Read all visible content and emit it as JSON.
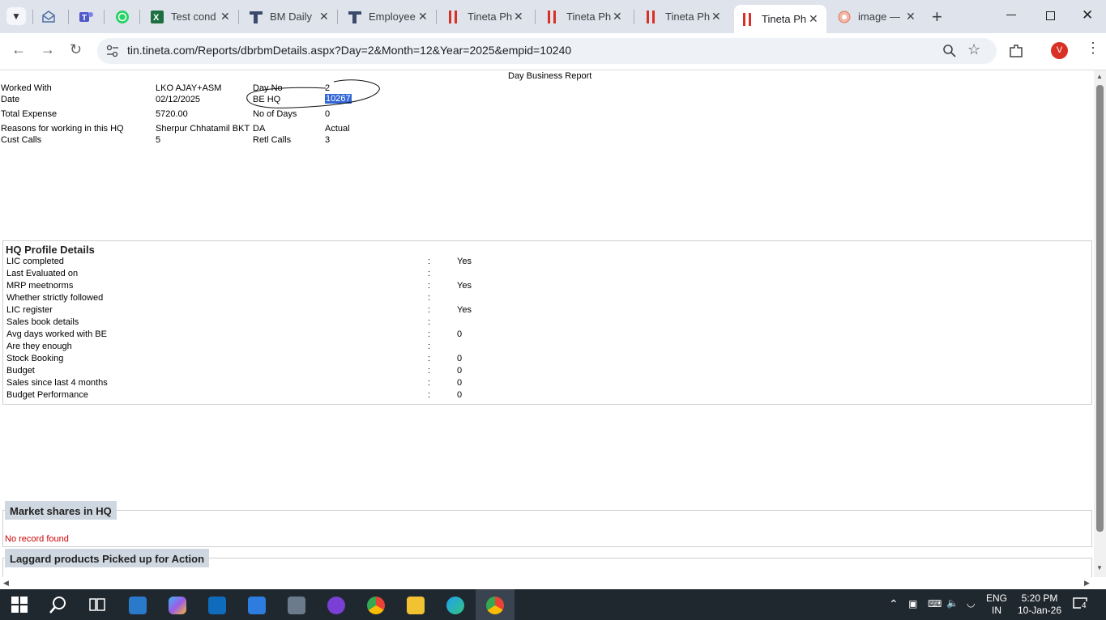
{
  "browser": {
    "tabs": [
      {
        "title": "",
        "icon": "tab-search-icon"
      },
      {
        "title": "",
        "icon": "mail-icon"
      },
      {
        "title": "",
        "icon": "teams-icon"
      },
      {
        "title": "",
        "icon": "whatsapp-icon"
      },
      {
        "title": "Test cond",
        "icon": "excel-icon"
      },
      {
        "title": "BM Daily",
        "icon": "tineta-t-icon"
      },
      {
        "title": "Employee",
        "icon": "tineta-t-icon"
      },
      {
        "title": "Tineta Ph",
        "icon": "tineta-bars-icon"
      },
      {
        "title": "Tineta Ph",
        "icon": "tineta-bars-icon"
      },
      {
        "title": "Tineta Ph",
        "icon": "tineta-bars-icon"
      },
      {
        "title": "Tineta Ph",
        "icon": "tineta-bars-icon"
      },
      {
        "title": "image —",
        "icon": "image-icon"
      }
    ],
    "url": "tin.tineta.com/Reports/dbrbmDetails.aspx?Day=2&Month=12&Year=2025&empid=10240",
    "profile_initial": "V"
  },
  "report": {
    "title": "Day Business Report",
    "fields": {
      "worked_with_label": "Worked With",
      "worked_with_value": "LKO AJAY+ASM",
      "date_label": "Date",
      "date_value": "02/12/2025",
      "total_expense_label": "Total Expense",
      "total_expense_value": "5720.00",
      "reasons_label": "Reasons for working in this HQ",
      "reasons_value": "Sherpur Chhatamil BKT",
      "cust_calls_label": "Cust Calls",
      "cust_calls_value": "5",
      "day_no_label": "Day No",
      "day_no_value": "2",
      "be_hq_label": "BE HQ",
      "be_hq_value": "10267",
      "no_of_days_label": "No of Days",
      "no_of_days_value": "0",
      "da_label": "DA",
      "da_value": "Actual",
      "retl_calls_label": "Retl Calls",
      "retl_calls_value": "3"
    },
    "hq_profile": {
      "heading": "HQ Profile Details",
      "rows": [
        {
          "label": "LIC completed",
          "sep": ":",
          "value": "Yes"
        },
        {
          "label": "Last Evaluated on",
          "sep": ":",
          "value": ""
        },
        {
          "label": "MRP meetnorms",
          "sep": ":",
          "value": "Yes"
        },
        {
          "label": "Whether strictly followed",
          "sep": ":",
          "value": ""
        },
        {
          "label": "LIC register",
          "sep": ":",
          "value": "Yes"
        },
        {
          "label": "Sales book details",
          "sep": ":",
          "value": ""
        },
        {
          "label": "Avg days worked with BE",
          "sep": ":",
          "value": "0"
        },
        {
          "label": "Are they enough",
          "sep": ":",
          "value": ""
        },
        {
          "label": "Stock Booking",
          "sep": ":",
          "value": "0"
        },
        {
          "label": "Budget",
          "sep": ":",
          "value": "0"
        },
        {
          "label": "Sales since last 4 months",
          "sep": ":",
          "value": "0"
        },
        {
          "label": "Budget Performance",
          "sep": ":",
          "value": "0"
        }
      ]
    },
    "market_shares": {
      "heading": "Market shares in HQ",
      "empty_text": "No record found"
    },
    "laggard": {
      "heading": "Laggard products Picked up for Action"
    }
  },
  "taskbar": {
    "lang_line1": "ENG",
    "lang_line2": "IN",
    "time": "5:20 PM",
    "date": "10-Jan-26",
    "notification_count": "4"
  },
  "colors": {
    "tab_strip": "#dfe3eb",
    "accent_red": "#d93025",
    "selection": "#3367d6",
    "section_header": "#cfd7e0",
    "no_record": "#cc0000",
    "taskbar": "#20282f"
  }
}
